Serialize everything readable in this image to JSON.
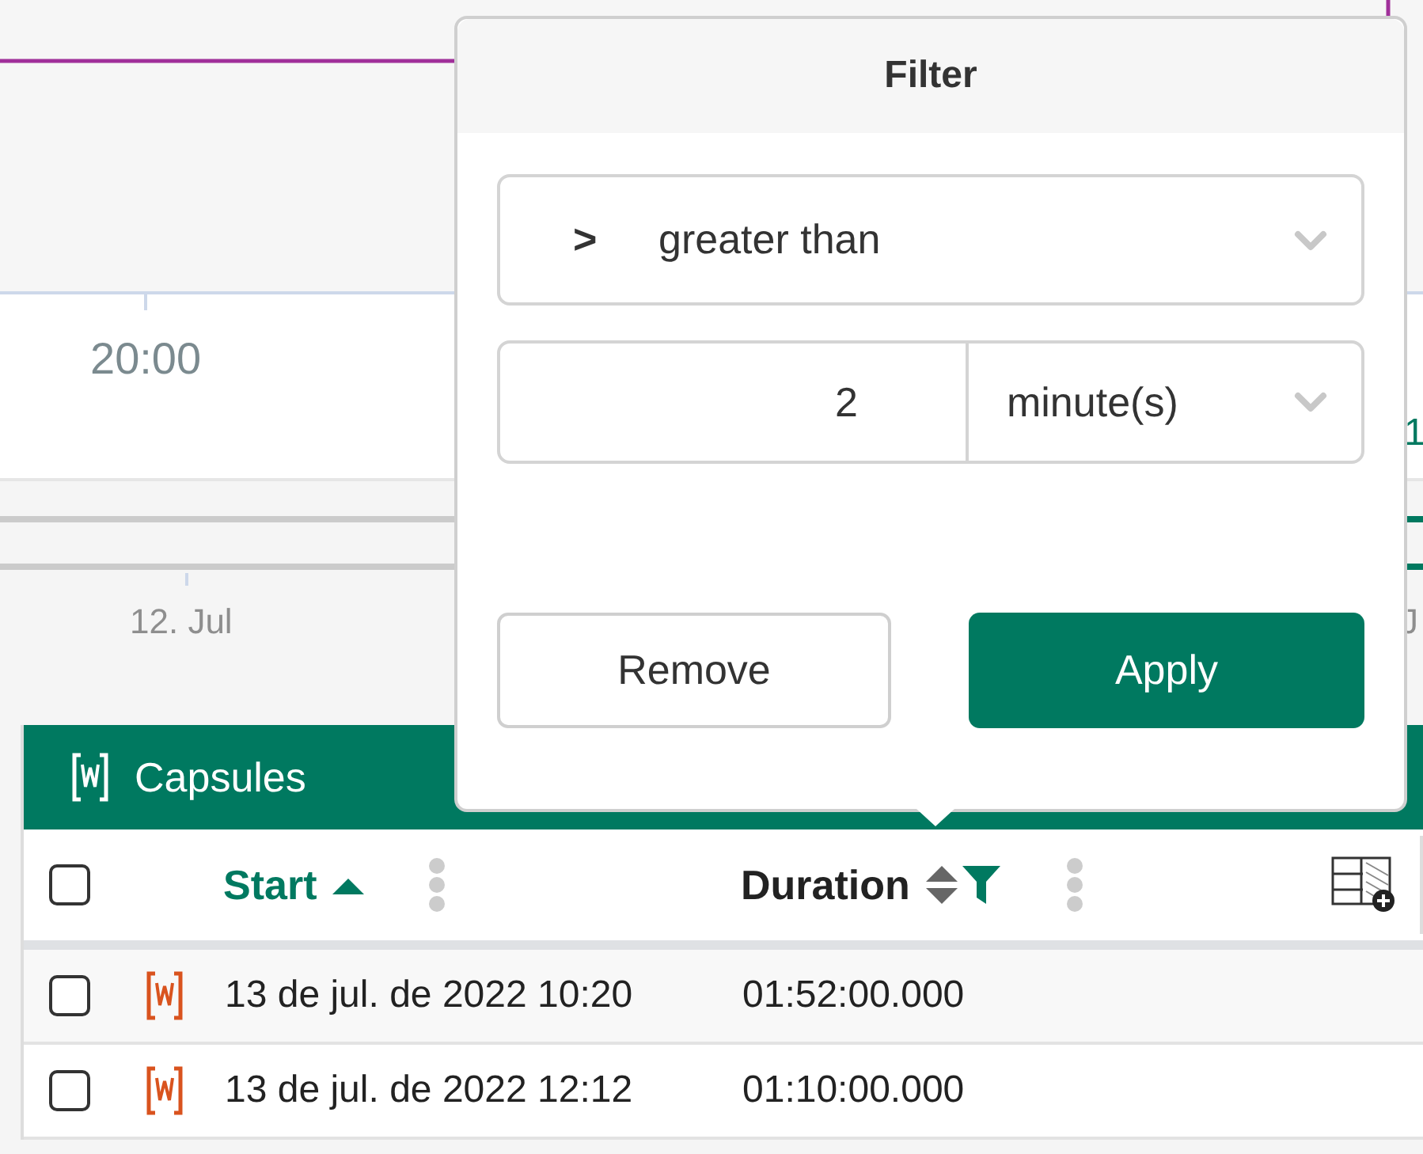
{
  "chart": {
    "x_labels": [
      "20:00"
    ],
    "right_label": "1"
  },
  "navigator": {
    "labels": [
      "12. Jul",
      "J"
    ]
  },
  "filter": {
    "title": "Filter",
    "operator": {
      "symbol": ">",
      "label": "greater than"
    },
    "value": "2",
    "unit": "minute(s)",
    "buttons": [
      {
        "label": "Remove",
        "kind": "secondary"
      },
      {
        "label": "Apply",
        "kind": "primary"
      }
    ]
  },
  "capsules": {
    "title": "Capsules",
    "header_checked": false,
    "columns": [
      {
        "label": "Start",
        "sorted": true,
        "filtered": false
      },
      {
        "label": "Duration",
        "sorted": false,
        "filtered": true
      }
    ],
    "rows": [
      {
        "checked": false,
        "start": "13 de jul. de 2022 10:20",
        "duration": "01:52:00.000"
      },
      {
        "checked": false,
        "start": "13 de jul. de 2022 12:12",
        "duration": "01:10:00.000"
      }
    ]
  }
}
